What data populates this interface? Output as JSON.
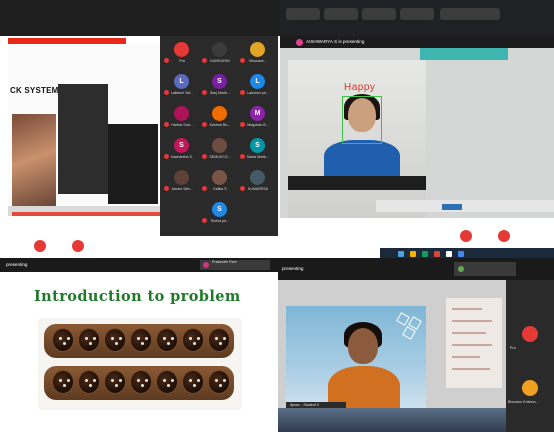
{
  "panel1": {
    "slide_title": "CK SYSTEM",
    "gallery": [
      {
        "initial": "",
        "name": "Pra",
        "color": "#e53935"
      },
      {
        "initial": "",
        "name": "KAVIKAYAN",
        "color": "#3b3b3b"
      },
      {
        "initial": "",
        "name": "Bhuvane...",
        "color": "#e0a526"
      },
      {
        "initial": "L",
        "name": "Lakshmi Sel...",
        "color": "#5c6bc0"
      },
      {
        "initial": "S",
        "name": "Sanj Murth...",
        "color": "#7b1fa2"
      },
      {
        "initial": "L",
        "name": "Lakshmi pri...",
        "color": "#1e88e5"
      },
      {
        "initial": "",
        "name": "Harhar Sud...",
        "color": "#ad1457"
      },
      {
        "initial": "",
        "name": "Krishna Ru...",
        "color": "#ef6c00"
      },
      {
        "initial": "M",
        "name": "Meguban B...",
        "color": "#8e24aa"
      },
      {
        "initial": "S",
        "name": "Nachantha S.",
        "color": "#c2185b"
      },
      {
        "initial": "",
        "name": "SEMUVCO...",
        "color": "#6d4c41"
      },
      {
        "initial": "S",
        "name": "Santa Murth...",
        "color": "#0097a7"
      },
      {
        "initial": "",
        "name": "Janani Seb...",
        "color": "#5d4037"
      },
      {
        "initial": "",
        "name": "Kalika S",
        "color": "#795548"
      },
      {
        "initial": "",
        "name": "KUMARESA",
        "color": "#455a64"
      },
      {
        "initial": "S",
        "name": "Sneha pri...",
        "color": "#1e88e5"
      }
    ]
  },
  "panel2": {
    "presenting": "AISHWARYA S is presenting",
    "emotion_label": "Happy"
  },
  "panel3": {
    "presenting": "presenting",
    "chip_name": "Prakavath Ram",
    "heading": "Introduction to problem"
  },
  "panel4": {
    "presenting": "presenting",
    "cam_label": "Apoor... Student 3",
    "side_labels": [
      "Pra",
      "Bhuvane Krishna..."
    ]
  }
}
